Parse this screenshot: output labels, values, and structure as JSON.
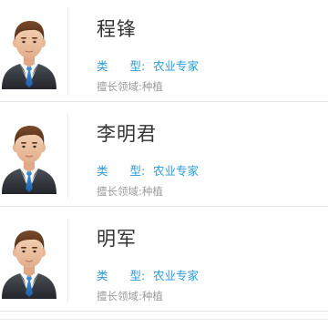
{
  "experts": [
    {
      "name": "程锋",
      "type_label_1": "类",
      "type_label_2": "型:",
      "type_value": "农业专家",
      "field_label": "擅长领域:",
      "field_value": "种植",
      "avatar_icon": "businessman-avatar-icon"
    },
    {
      "name": "李明君",
      "type_label_1": "类",
      "type_label_2": "型:",
      "type_value": "农业专家",
      "field_label": "擅长领域:",
      "field_value": "种植",
      "avatar_icon": "businessman-avatar-icon"
    },
    {
      "name": "明军",
      "type_label_1": "类",
      "type_label_2": "型:",
      "type_value": "农业专家",
      "field_label": "擅长领域:",
      "field_value": "种植",
      "avatar_icon": "businessman-avatar-icon"
    }
  ],
  "colors": {
    "type_text": "#2a9bd8",
    "field_text": "#9a9a9a",
    "name_text": "#333333"
  }
}
